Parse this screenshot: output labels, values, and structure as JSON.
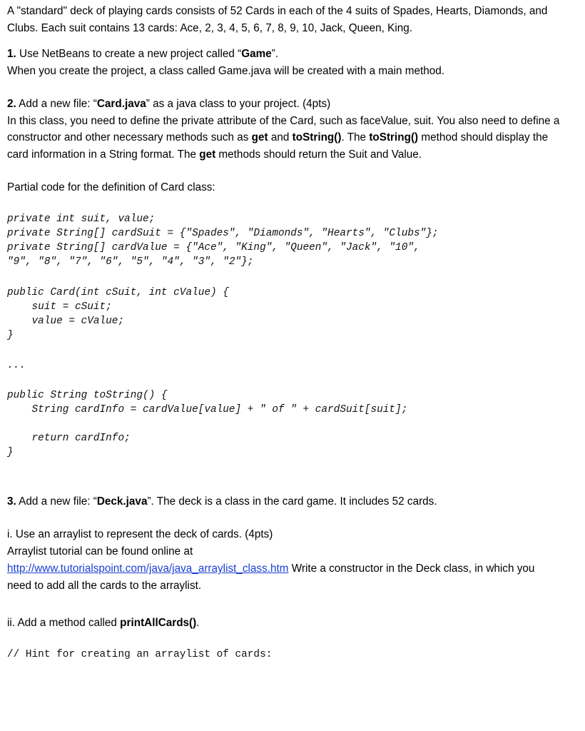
{
  "colors": {
    "text": "#000000",
    "link": "#1a3fd4",
    "background": "#ffffff",
    "code_text": "#111111"
  },
  "intro": {
    "paragraph_part1": "A \"standard\" deck of playing cards consists of 52 Cards in each of the 4 suits of Spades, Hearts, Diamonds, and Clubs. Each suit contains 13 cards: Ace, 2, 3, 4, 5, 6, 7, 8, 9, 10, Jack, Queen, King."
  },
  "step1": {
    "number": "1.",
    "text_before": " Use NetBeans to create a new project called “",
    "bold_term": "Game",
    "text_after": "”.",
    "line2": "When you create the project, a class called Game.java will be created with a main method."
  },
  "step2": {
    "number": "2.",
    "text_before": " Add a new file: “",
    "bold_term": "Card.java",
    "text_after": "” as a java class to your project. (4pts)",
    "body_seg1": "In this class, you need to define the private attribute of the Card, such as faceValue, suit. You also need to define a constructor and other necessary methods such as ",
    "body_bold1": "get",
    "body_seg2": " and ",
    "body_bold2": "toString()",
    "body_seg3": ". The ",
    "body_bold3": "toString()",
    "body_seg4": " method should display the card information in a String format. The ",
    "body_bold4": "get",
    "body_seg5": " methods should return the Suit and Value.",
    "partial_code_caption": "Partial code for the definition of Card class:",
    "code_block_1": "private int suit, value;\nprivate String[] cardSuit = {\"Spades\", \"Diamonds\", \"Hearts\", \"Clubs\"};\nprivate String[] cardValue = {\"Ace\", \"King\", \"Queen\", \"Jack\", \"10\",\n\"9\", \"8\", \"7\", \"6\", \"5\", \"4\", \"3\", \"2\"};",
    "code_block_2": "public Card(int cSuit, int cValue) {\n    suit = cSuit;\n    value = cValue;\n}",
    "code_ellipsis": "...",
    "code_block_3": "public String toString() {\n    String cardInfo = cardValue[value] + \" of \" + cardSuit[suit];\n\n    return cardInfo;\n}"
  },
  "step3": {
    "number": "3.",
    "text_before": " Add a new file: “",
    "bold_term": "Deck.java",
    "text_after": "”. The deck is a class in the card game. It includes 52 cards.",
    "sub_i": {
      "label_line": "i. Use an arraylist to represent the deck of cards. (4pts)",
      "tutorial_line": "Arraylist tutorial can be found online at",
      "link_text": "http://www.tutorialspoint.com/java/java_arraylist_class.htm",
      "after_link": " Write a constructor in the Deck class, in which you need to add all the cards to the arraylist."
    },
    "sub_ii": {
      "text_before": "ii. Add a method called ",
      "bold_term": "printAllCards()",
      "text_after": ".",
      "hint_comment": "// Hint for creating an arraylist of cards:"
    }
  }
}
